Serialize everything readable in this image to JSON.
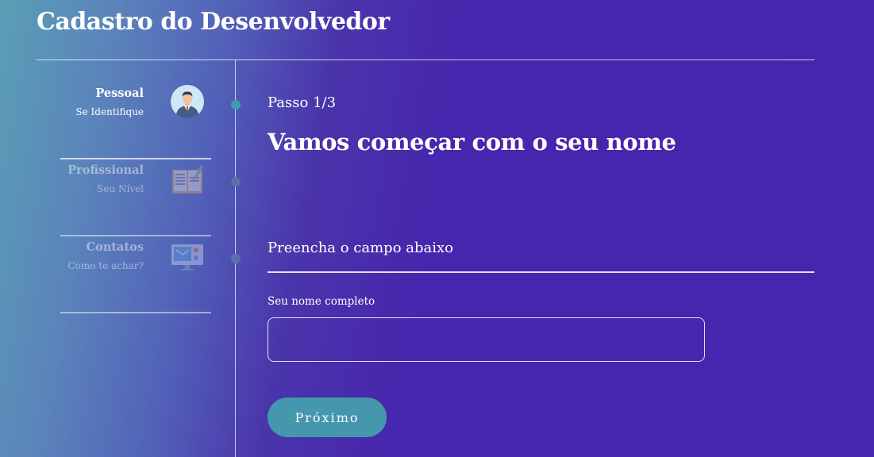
{
  "header": {
    "title": "Cadastro do Desenvolvedor"
  },
  "steps": [
    {
      "title": "Pessoal",
      "subtitle": "Se Identifique",
      "icon": "user-avatar-icon",
      "active": true
    },
    {
      "title": "Profissional",
      "subtitle": "Seu Nível",
      "icon": "notebook-pencil-icon",
      "active": false
    },
    {
      "title": "Contatos",
      "subtitle": "Como te achar?",
      "icon": "monitor-contacts-icon",
      "active": false
    }
  ],
  "main": {
    "step_counter": "Passo 1/3",
    "headline": "Vamos começar com o seu nome",
    "instruction": "Preencha o campo abaixo",
    "field_label": "Seu nome completo",
    "field_value": "",
    "next_label": "Próximo"
  },
  "colors": {
    "background": "#4626ad",
    "gradient_left": "#5a9fb5",
    "active_dot": "#3e9bb0",
    "inactive_dot": "#5b6fa8",
    "button": "#4497ac"
  }
}
